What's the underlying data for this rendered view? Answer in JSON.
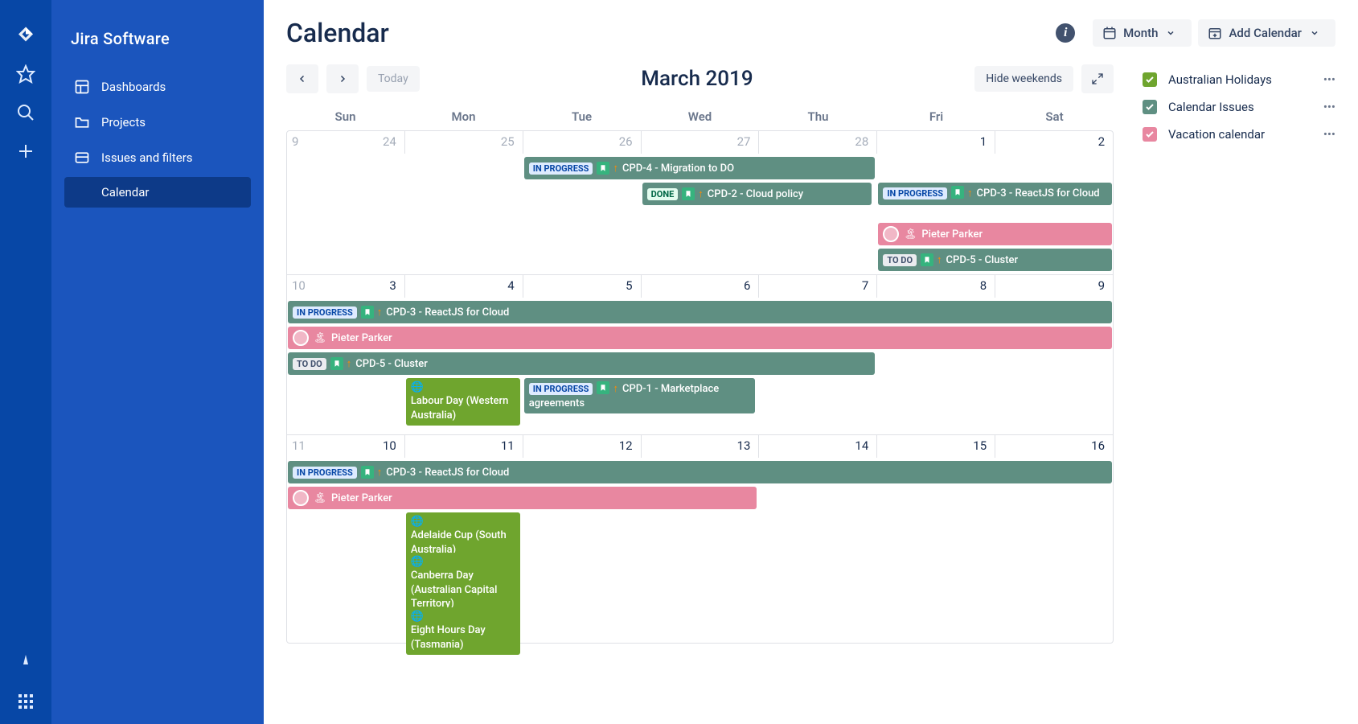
{
  "app_title": "Jira Software",
  "sidebar": {
    "items": [
      {
        "label": "Dashboards",
        "icon": "dashboard"
      },
      {
        "label": "Projects",
        "icon": "folder"
      },
      {
        "label": "Issues and filters",
        "icon": "queue"
      },
      {
        "label": "Calendar",
        "icon": "none",
        "active": true
      }
    ]
  },
  "header": {
    "title": "Calendar",
    "view_label": "Month",
    "add_label": "Add Calendar"
  },
  "toolbar": {
    "today": "Today",
    "month": "March 2019",
    "hide_weekends": "Hide weekends"
  },
  "dow": [
    "Sun",
    "Mon",
    "Tue",
    "Wed",
    "Thu",
    "Fri",
    "Sat"
  ],
  "weeks": [
    {
      "wk": "9",
      "days": [
        {
          "n": "24",
          "out": true
        },
        {
          "n": "25",
          "out": true
        },
        {
          "n": "26",
          "out": true
        },
        {
          "n": "27",
          "out": true
        },
        {
          "n": "28",
          "out": true
        },
        {
          "n": "1"
        },
        {
          "n": "2"
        }
      ]
    },
    {
      "wk": "10",
      "days": [
        {
          "n": "3"
        },
        {
          "n": "4"
        },
        {
          "n": "5"
        },
        {
          "n": "6"
        },
        {
          "n": "7"
        },
        {
          "n": "8"
        },
        {
          "n": "9"
        }
      ]
    },
    {
      "wk": "11",
      "days": [
        {
          "n": "10"
        },
        {
          "n": "11"
        },
        {
          "n": "12"
        },
        {
          "n": "13"
        },
        {
          "n": "14"
        },
        {
          "n": "15"
        },
        {
          "n": "16"
        }
      ]
    }
  ],
  "events": {
    "w0": {
      "cpd4": {
        "status": "IN PROGRESS",
        "text": "CPD-4 - Migration to DO"
      },
      "cpd2": {
        "status": "DONE",
        "text": "CPD-2 - Cloud policy"
      },
      "cpd3": {
        "status": "IN PROGRESS",
        "text": "CPD-3 - ReactJS for Cloud"
      },
      "vac": {
        "text": "Pieter Parker"
      },
      "cpd5": {
        "status": "TO DO",
        "text": "CPD-5 - Cluster"
      }
    },
    "w1": {
      "cpd3": {
        "status": "IN PROGRESS",
        "text": "CPD-3 - ReactJS for Cloud"
      },
      "vac": {
        "text": "Pieter Parker"
      },
      "cpd5": {
        "status": "TO DO",
        "text": "CPD-5 - Cluster"
      },
      "labour": {
        "text": "Labour Day (Western Australia)"
      },
      "cpd1": {
        "status": "IN PROGRESS",
        "text": "CPD-1 - Marketplace agreements"
      }
    },
    "w2": {
      "cpd3": {
        "status": "IN PROGRESS",
        "text": "CPD-3 - ReactJS for Cloud"
      },
      "vac": {
        "text": "Pieter Parker"
      },
      "adelaide": {
        "text": "Adelaide Cup (South Australia)"
      },
      "canberra": {
        "text": "Canberra Day (Australian Capital Territory)"
      },
      "eight": {
        "text": "Eight Hours Day (Tasmania)"
      }
    }
  },
  "legend": [
    {
      "label": "Australian Holidays",
      "color": "#6fa52e"
    },
    {
      "label": "Calendar Issues",
      "color": "#5f8f82"
    },
    {
      "label": "Vacation calendar",
      "color": "#e887a0"
    }
  ]
}
